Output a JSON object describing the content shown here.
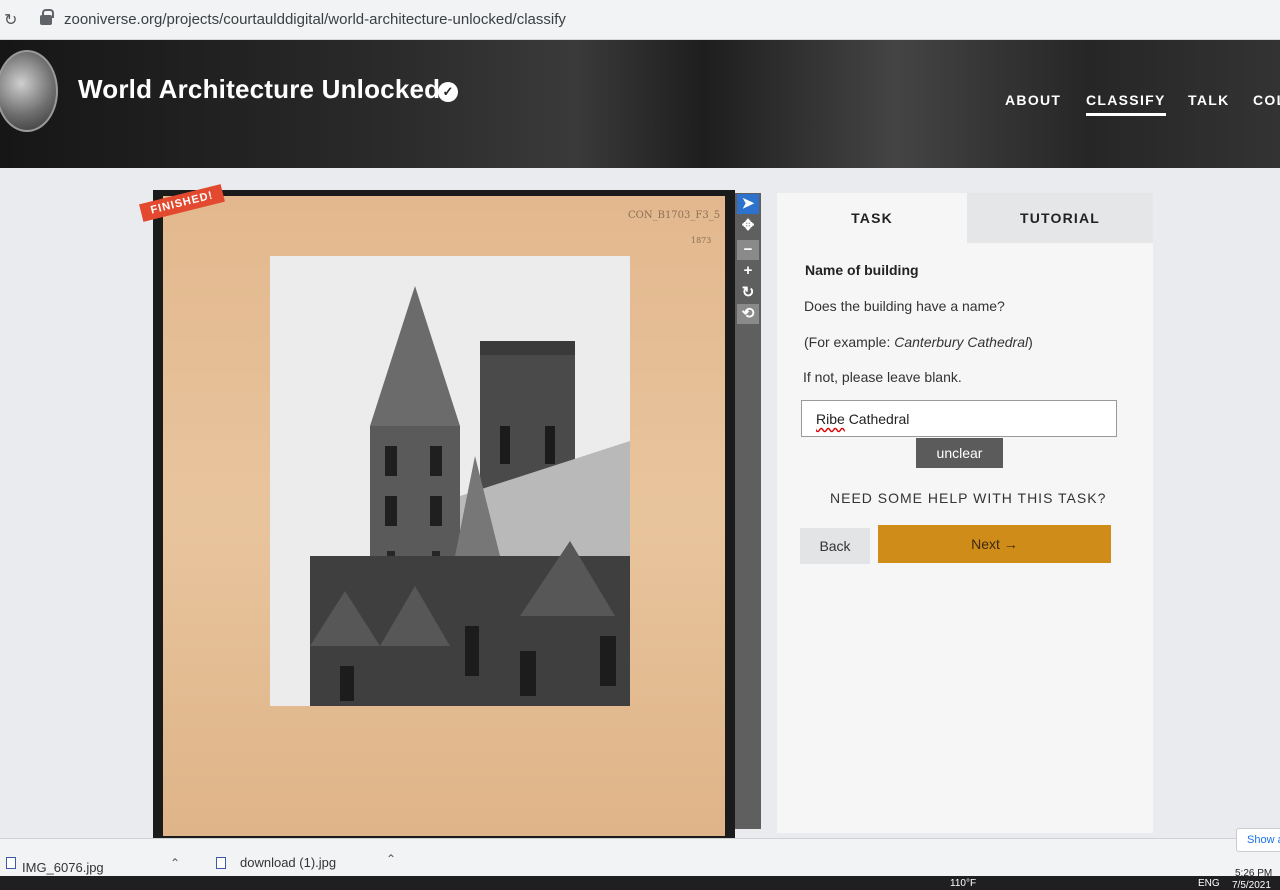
{
  "browser": {
    "url": "zooniverse.org/projects/courtaulddigital/world-architecture-unlocked/classify"
  },
  "header": {
    "title": "World Architecture Unlocked",
    "nav": [
      "ABOUT",
      "CLASSIFY",
      "TALK",
      "COL"
    ],
    "active_nav": "CLASSIFY"
  },
  "subject": {
    "badge": "FINISHED!",
    "ref_code": "CON_B1703_F3_5",
    "ref_num": "1873"
  },
  "task_panel": {
    "tabs": [
      "TASK",
      "TUTORIAL"
    ],
    "question_title": "Name of building",
    "question": "Does the building have a name?",
    "example_prefix": "(For example: ",
    "example_name": "Canterbury Cathedral",
    "example_suffix": ")",
    "instruction": "If not, please leave blank.",
    "answer_value": "Cathedral",
    "answer_first_word": "Ribe",
    "unclear_label": "unclear",
    "help_label": "NEED SOME HELP WITH THIS TASK?",
    "back_label": "Back",
    "next_label": "Next →"
  },
  "downloads": {
    "items": [
      "IMG_6076.jpg",
      "download (1).jpg"
    ],
    "show_all": "Show a"
  },
  "taskbar": {
    "temperature": "110°F",
    "lang": "ENG",
    "time": "5:26 PM",
    "date": "7/5/2021"
  },
  "colors": {
    "accent_next": "#d08c18",
    "badge_red": "#e2492f",
    "tool_selected": "#2d73ce"
  }
}
